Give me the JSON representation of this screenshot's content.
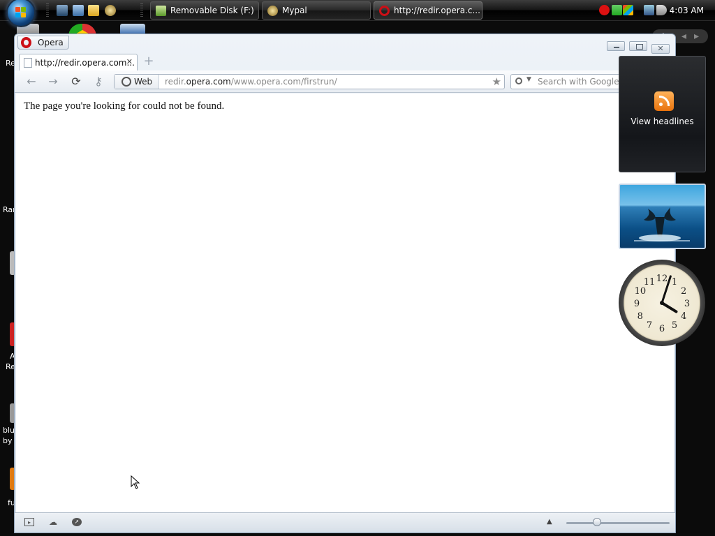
{
  "desktop": {
    "icon_labels": [
      "Re",
      "Ran",
      "A",
      "Re",
      "blu",
      "by",
      "fu"
    ]
  },
  "taskbar": {
    "buttons": [
      {
        "label": "Removable Disk (F:)"
      },
      {
        "label": "Mypal"
      },
      {
        "label": "http://redir.opera.c..."
      }
    ],
    "clock": "4:03 AM"
  },
  "browser": {
    "app_menu_label": "Opera",
    "tab": {
      "title": "http://redir.opera.com...",
      "close": "✕"
    },
    "new_tab_glyph": "+",
    "address": {
      "badge": "Web",
      "url_prefix": "redir.",
      "url_domain": "opera.com",
      "url_path": "/www.opera.com/firstrun/"
    },
    "search_placeholder": "Search with Google",
    "page": {
      "message": "The page you're looking for could not be found."
    },
    "status": {
      "zoom_level": 0.3
    }
  },
  "gadgets": {
    "feed_label": "View headlines",
    "clock_time": "4:03",
    "clock_numbers": [
      "12",
      "1",
      "2",
      "3",
      "4",
      "5",
      "6",
      "7",
      "8",
      "9",
      "10",
      "11"
    ]
  },
  "icons": {
    "start": "windows-flag-icon",
    "feed": "rss-icon",
    "star": "★",
    "search": "magnifier-icon"
  },
  "colors": {
    "opera_red": "#cc0f16",
    "rss_orange": "#f08a24",
    "taskbar": "#0a0a0a"
  }
}
